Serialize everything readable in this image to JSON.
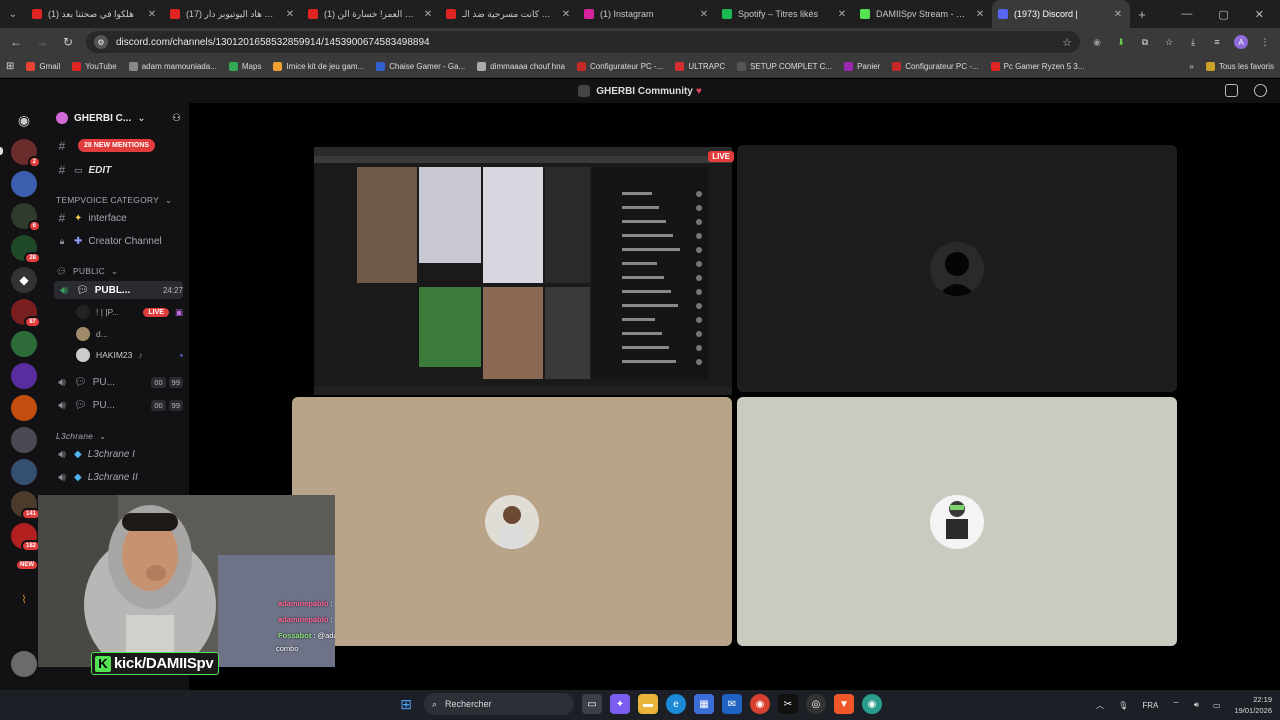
{
  "browser": {
    "tabs": [
      {
        "title": "(1) هلكوا في صحتنا بعد",
        "color": "#e02424"
      },
      {
        "title": "(17) علاش هاد اليوتيوبر دار",
        "color": "#e02424"
      },
      {
        "title": "(1) صدمة العمر! خسارة الن",
        "color": "#e02424"
      },
      {
        "title": "واش كانت مسرحية ضد الـ",
        "color": "#e02424"
      },
      {
        "title": "(1) Instagram",
        "color": "#d6249f"
      },
      {
        "title": "Spotify – Titres likés",
        "color": "#1db954"
      },
      {
        "title": "DAMIISpv Stream - Watch",
        "color": "#52e252"
      },
      {
        "title": "(1973) Discord |",
        "color": "#5865f2"
      }
    ],
    "new_tab": "+",
    "url": "discord.com/channels/1301201658532859914/1453900674583498894",
    "bookmarks": [
      {
        "label": "Gmail",
        "color": "#ea4335"
      },
      {
        "label": "YouTube",
        "color": "#e02424"
      },
      {
        "label": "adam mamouniada...",
        "color": "#888"
      },
      {
        "label": "Maps",
        "color": "#34a853"
      },
      {
        "label": "Imice kit de jeu gam...",
        "color": "#f0a030"
      },
      {
        "label": "Chaise Gamer - Ga...",
        "color": "#3060d0"
      },
      {
        "label": "dimmaaaa chouf hna",
        "color": "#aaa"
      },
      {
        "label": "Configurateur PC -...",
        "color": "#c62828"
      },
      {
        "label": "ULTRAPC",
        "color": "#d32f2f"
      },
      {
        "label": "SETUP COMPLET C...",
        "color": "#555"
      },
      {
        "label": "Panier",
        "color": "#9c27b0"
      },
      {
        "label": "Configurateur PC -...",
        "color": "#c62828"
      },
      {
        "label": "Pc Gamer Ryzen 5 3...",
        "color": "#e02424"
      }
    ],
    "bookmarks_more": "»",
    "all_bookmarks": "Tous les favoris"
  },
  "discord": {
    "community_title": "GHERBI Community",
    "server_name": "GHERBI C...",
    "new_mentions": "28 NEW MENTIONS",
    "channels": {
      "edit": "EDIT",
      "tempvoice_category": "TEMPVOICE CATEGORY",
      "interface": "interface",
      "creator_channel": "Creator Channel",
      "public_category": "PUBLIC",
      "public_channel": "PUBL...",
      "public_time": "24:27",
      "user1": "! | |P...",
      "user1_live": "LIVE",
      "user2": "d...",
      "user3": "HAKIM23",
      "voice_pu1": "PU...",
      "voice_pu1_counts": [
        "00",
        "99"
      ],
      "voice_pu2": "PU...",
      "voice_pu2_counts": [
        "00",
        "99"
      ],
      "l3chrane_category": "L3chrane",
      "l3chrane1": "L3chrane I",
      "l3chrane2": "L3chrane II"
    },
    "guild_badges": [
      "2",
      "6",
      "28",
      "87",
      "141",
      "182",
      "NEW"
    ],
    "stream_live": "LIVE"
  },
  "overlay": {
    "chat": [
      {
        "user": "adaminepablo",
        "text": ":"
      },
      {
        "user": "adaminepablo",
        "text": ":"
      },
      {
        "user": "Fossabot",
        "text": ": @adaminepablo, 3x"
      },
      {
        "user": "",
        "text": "combo"
      }
    ],
    "kick_handle": "kick/DAMIISpv"
  },
  "taskbar": {
    "search_placeholder": "Rechercher",
    "lang": "FRA",
    "time": "22:19",
    "date": "19/01/2026"
  }
}
